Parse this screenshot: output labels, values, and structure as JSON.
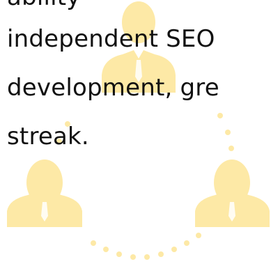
{
  "lines": [
    "ability",
    "independent SEO",
    "development,  gre",
    "streak."
  ],
  "colors": {
    "text": "#111111",
    "illustration": "#fde9a6",
    "dots": "#fde9a6"
  },
  "illustration": {
    "figures": [
      "businessman-icon",
      "businessman-icon",
      "businessman-icon"
    ],
    "connector": "dotted-circle"
  }
}
